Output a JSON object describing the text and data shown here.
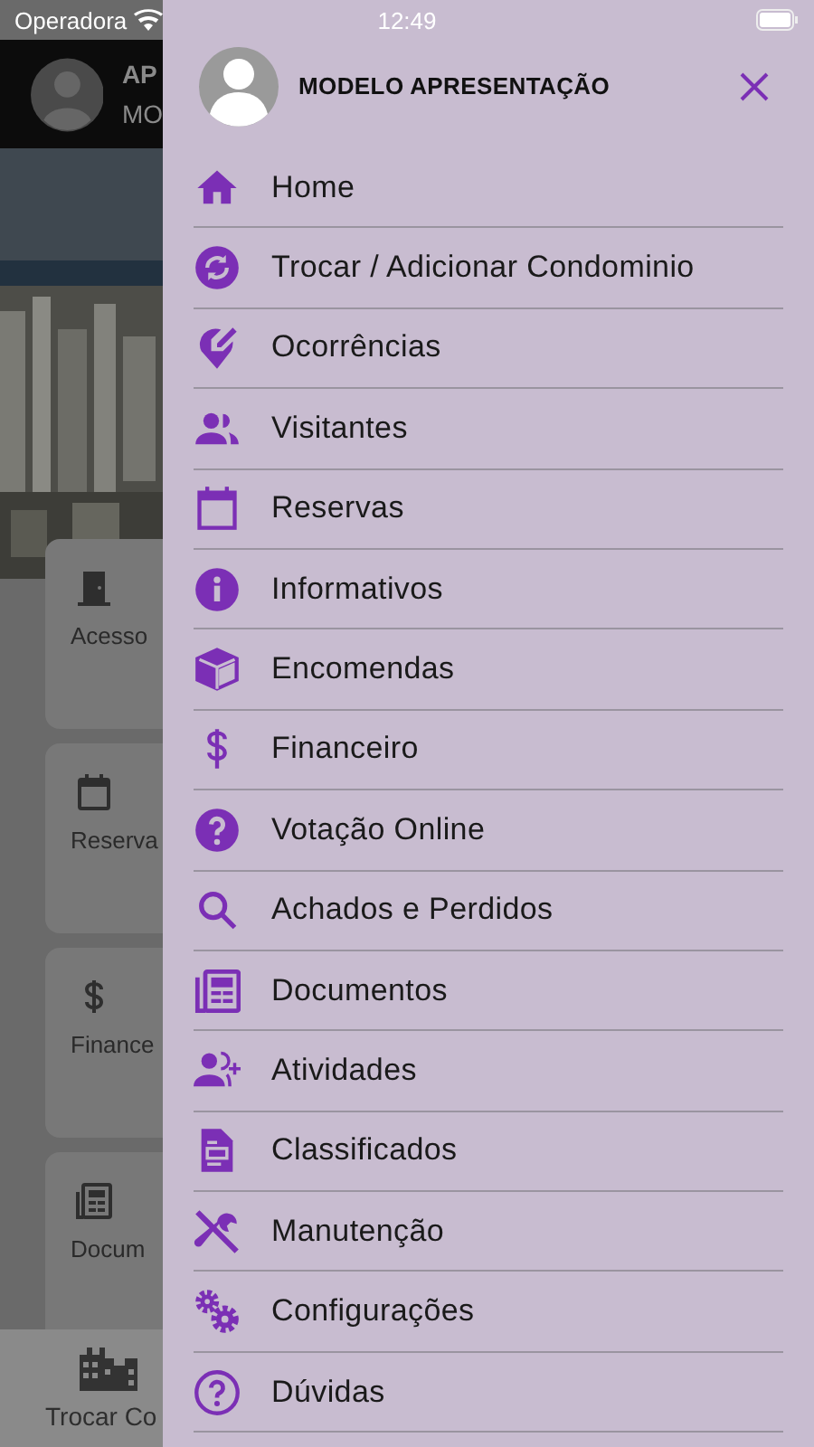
{
  "status_bar": {
    "carrier": "Operadora",
    "time": "12:49"
  },
  "background": {
    "header": {
      "line_1": "AP",
      "line_2": "MO"
    },
    "cards": [
      {
        "label": "Acesso"
      },
      {
        "label": "Reserva"
      },
      {
        "label": "Finance"
      },
      {
        "label": "Docum"
      }
    ],
    "bottom_tab": {
      "label": "Trocar Co"
    }
  },
  "drawer": {
    "user_name": "MODELO APRESENTAÇÃO",
    "items": [
      {
        "label": "Home"
      },
      {
        "label": "Trocar / Adicionar Condominio"
      },
      {
        "label": "Ocorrências"
      },
      {
        "label": "Visitantes"
      },
      {
        "label": "Reservas"
      },
      {
        "label": "Informativos"
      },
      {
        "label": "Encomendas"
      },
      {
        "label": "Financeiro"
      },
      {
        "label": "Votação Online"
      },
      {
        "label": "Achados e Perdidos"
      },
      {
        "label": "Documentos"
      },
      {
        "label": "Atividades"
      },
      {
        "label": "Classificados"
      },
      {
        "label": "Manutenção"
      },
      {
        "label": "Configurações"
      },
      {
        "label": "Dúvidas"
      }
    ]
  }
}
